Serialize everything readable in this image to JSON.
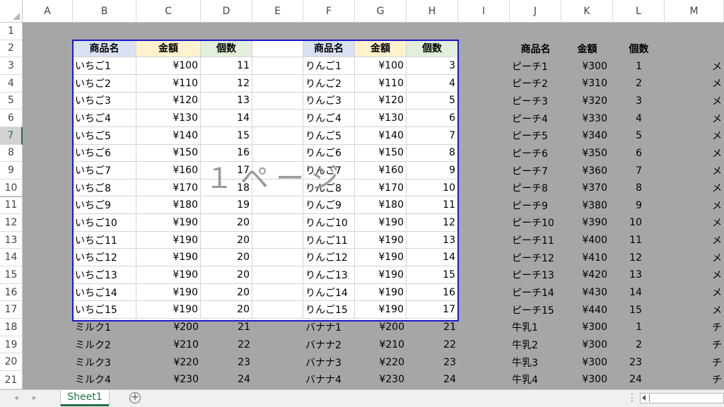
{
  "columns": [
    "A",
    "B",
    "C",
    "D",
    "E",
    "F",
    "G",
    "H",
    "I",
    "J",
    "K",
    "L",
    "M"
  ],
  "rows": [
    "1",
    "2",
    "3",
    "4",
    "5",
    "6",
    "7",
    "8",
    "9",
    "10",
    "11",
    "12",
    "13",
    "14",
    "15",
    "16",
    "17",
    "18",
    "19",
    "20",
    "21"
  ],
  "selected_row": "7",
  "headers": {
    "group1": [
      "商品名",
      "金額",
      "個数"
    ],
    "group2": [
      "商品名",
      "金額",
      "個数"
    ],
    "group3": [
      "商品名",
      "金額",
      "個数"
    ]
  },
  "header_colors": {
    "name": "#d9e1f2",
    "price": "#fff2cc",
    "qty": "#e2efda"
  },
  "data": {
    "group1": [
      [
        "いちご1",
        "¥100",
        "11"
      ],
      [
        "いちご2",
        "¥110",
        "12"
      ],
      [
        "いちご3",
        "¥120",
        "13"
      ],
      [
        "いちご4",
        "¥130",
        "14"
      ],
      [
        "いちご5",
        "¥140",
        "15"
      ],
      [
        "いちご6",
        "¥150",
        "16"
      ],
      [
        "いちご7",
        "¥160",
        "17"
      ],
      [
        "いちご8",
        "¥170",
        "18"
      ],
      [
        "いちご9",
        "¥180",
        "19"
      ],
      [
        "いちご10",
        "¥190",
        "20"
      ],
      [
        "いちご11",
        "¥190",
        "20"
      ],
      [
        "いちご12",
        "¥190",
        "20"
      ],
      [
        "いちご13",
        "¥190",
        "20"
      ],
      [
        "いちご14",
        "¥190",
        "20"
      ],
      [
        "いちご15",
        "¥190",
        "20"
      ],
      [
        "ミルク1",
        "¥200",
        "21"
      ],
      [
        "ミルク2",
        "¥210",
        "22"
      ],
      [
        "ミルク3",
        "¥220",
        "23"
      ],
      [
        "ミルク4",
        "¥230",
        "24"
      ]
    ],
    "group2": [
      [
        "りんご1",
        "¥100",
        "3"
      ],
      [
        "りんご2",
        "¥110",
        "4"
      ],
      [
        "りんご3",
        "¥120",
        "5"
      ],
      [
        "りんご4",
        "¥130",
        "6"
      ],
      [
        "りんご5",
        "¥140",
        "7"
      ],
      [
        "りんご6",
        "¥150",
        "8"
      ],
      [
        "りんご7",
        "¥160",
        "9"
      ],
      [
        "りんご8",
        "¥170",
        "10"
      ],
      [
        "りんご9",
        "¥180",
        "11"
      ],
      [
        "りんご10",
        "¥190",
        "12"
      ],
      [
        "りんご11",
        "¥190",
        "13"
      ],
      [
        "りんご12",
        "¥190",
        "14"
      ],
      [
        "りんご13",
        "¥190",
        "15"
      ],
      [
        "りんご14",
        "¥190",
        "16"
      ],
      [
        "りんご15",
        "¥190",
        "17"
      ],
      [
        "バナナ1",
        "¥200",
        "21"
      ],
      [
        "バナナ2",
        "¥210",
        "22"
      ],
      [
        "バナナ3",
        "¥220",
        "23"
      ],
      [
        "バナナ4",
        "¥230",
        "24"
      ]
    ],
    "group3": [
      [
        "ピーチ1",
        "¥300",
        "1"
      ],
      [
        "ピーチ2",
        "¥310",
        "2"
      ],
      [
        "ピーチ3",
        "¥320",
        "3"
      ],
      [
        "ピーチ4",
        "¥330",
        "4"
      ],
      [
        "ピーチ5",
        "¥340",
        "5"
      ],
      [
        "ピーチ6",
        "¥350",
        "6"
      ],
      [
        "ピーチ7",
        "¥360",
        "7"
      ],
      [
        "ピーチ8",
        "¥370",
        "8"
      ],
      [
        "ピーチ9",
        "¥380",
        "9"
      ],
      [
        "ピーチ10",
        "¥390",
        "10"
      ],
      [
        "ピーチ11",
        "¥400",
        "11"
      ],
      [
        "ピーチ12",
        "¥410",
        "12"
      ],
      [
        "ピーチ13",
        "¥420",
        "13"
      ],
      [
        "ピーチ14",
        "¥430",
        "14"
      ],
      [
        "ピーチ15",
        "¥440",
        "15"
      ],
      [
        "牛乳1",
        "¥300",
        "1"
      ],
      [
        "牛乳2",
        "¥300",
        "2"
      ],
      [
        "牛乳3",
        "¥300",
        "23"
      ],
      [
        "牛乳4",
        "¥300",
        "24"
      ]
    ],
    "col_m": [
      "メ",
      "メ",
      "メ",
      "メ",
      "メ",
      "メ",
      "メ",
      "メ",
      "メ",
      "メ",
      "メ",
      "メ",
      "メ",
      "メ",
      "メ",
      "チ",
      "チ",
      "チ",
      "チ"
    ]
  },
  "watermark": "１ページ",
  "sheet_tab": "Sheet1",
  "add_sheet_symbol": "+",
  "nav": {
    "prev": "◂",
    "next": "▸",
    "dots": "⋮"
  }
}
